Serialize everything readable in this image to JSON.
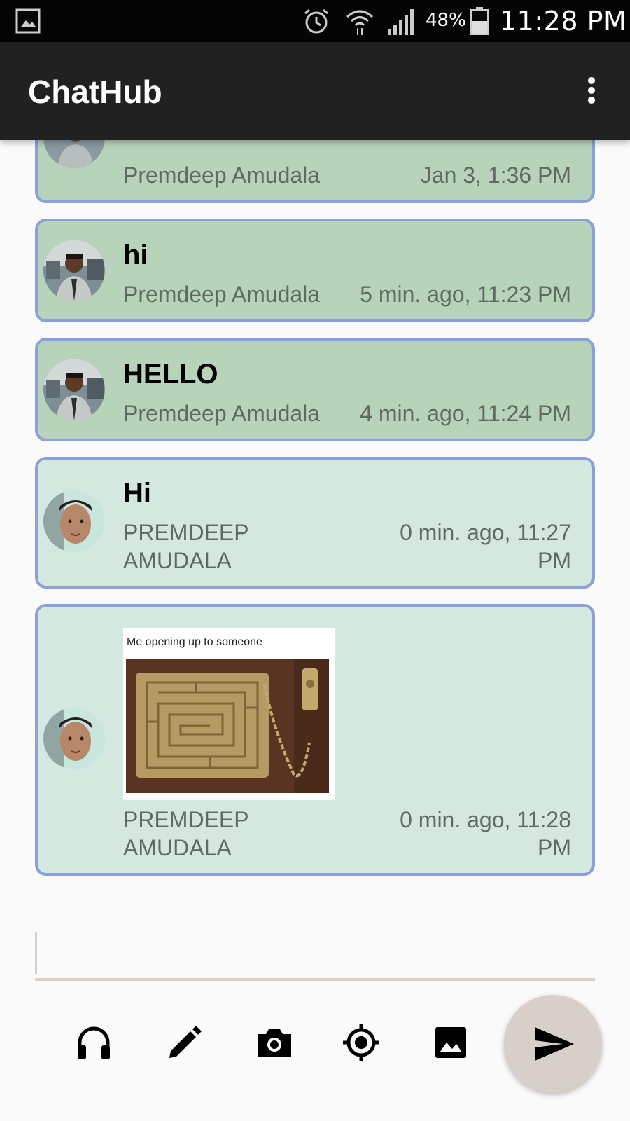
{
  "status_bar": {
    "battery_percent": "48%",
    "time": "11:28 PM"
  },
  "app_bar": {
    "title": "ChatHub"
  },
  "messages": [
    {
      "text": "",
      "sender": "Premdeep Amudala",
      "time": "Jan 3, 1:36 PM"
    },
    {
      "text": "hi",
      "sender": "Premdeep Amudala",
      "time": "5 min. ago, 11:23 PM"
    },
    {
      "text": "HELLO",
      "sender": "Premdeep Amudala",
      "time": "4 min. ago, 11:24 PM"
    },
    {
      "text": "Hi",
      "sender_line1": "PREMDEEP",
      "sender_line2": "AMUDALA",
      "time_line1": "0 min. ago, 11:27",
      "time_line2": "PM"
    },
    {
      "image_caption": "Me opening up to someone",
      "sender_line1": "PREMDEEP",
      "sender_line2": "AMUDALA",
      "time_line1": "0 min. ago, 11:28",
      "time_line2": "PM"
    }
  ],
  "composer": {
    "value": "",
    "placeholder": ""
  },
  "toolbar": {
    "icons": [
      "headphones-icon",
      "pencil-icon",
      "camera-icon",
      "location-icon",
      "image-icon",
      "send-icon"
    ]
  },
  "colors": {
    "status_bar": "#050505",
    "app_bar": "#212121",
    "bubble_received": "#b7d3b9",
    "bubble_sent": "#d5e8df",
    "bubble_border": "#8c9fdb",
    "send_button": "#d8cfca"
  }
}
